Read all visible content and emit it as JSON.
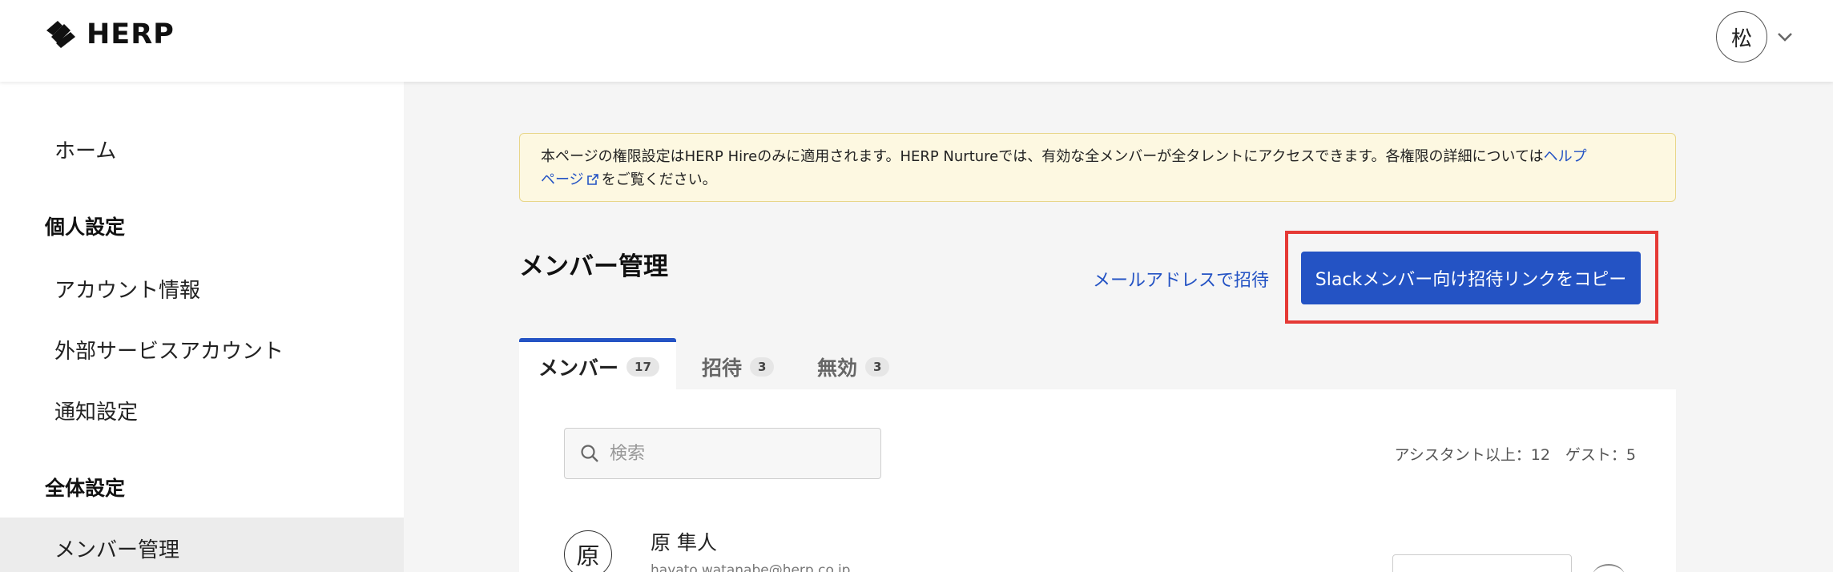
{
  "header": {
    "logo_text": "HERP",
    "user_initial": "松"
  },
  "sidebar": {
    "home": "ホーム",
    "personal_section": "個人設定",
    "account_info": "アカウント情報",
    "external_accounts": "外部サービスアカウント",
    "notification_settings": "通知設定",
    "global_section": "全体設定",
    "member_management": "メンバー管理"
  },
  "notice": {
    "text": "本ページの権限設定はHERP Hireのみに適用されます。HERP Nurtureでは、有効な全メンバーが全タレントにアクセスできます。各権限の詳細については",
    "link_text_1": "ヘルプ",
    "link_text_2": "ページ",
    "suffix": "をご覧ください。"
  },
  "main": {
    "title": "メンバー管理",
    "invite_email_link": "メールアドレスで招待",
    "slack_button": "Slackメンバー向け招待リンクをコピー"
  },
  "tabs": [
    {
      "label": "メンバー",
      "count": "17"
    },
    {
      "label": "招待",
      "count": "3"
    },
    {
      "label": "無効",
      "count": "3"
    }
  ],
  "search": {
    "placeholder": "検索"
  },
  "stats": {
    "text": "アシスタント以上：12　ゲスト：5"
  },
  "members": [
    {
      "initial": "原",
      "name": "原 隼人",
      "email": "hayato.watanabe@herp.co.jp"
    }
  ],
  "colors": {
    "accent": "#2453c4",
    "highlight": "#e53935",
    "notice_bg": "#fdf8e1"
  }
}
